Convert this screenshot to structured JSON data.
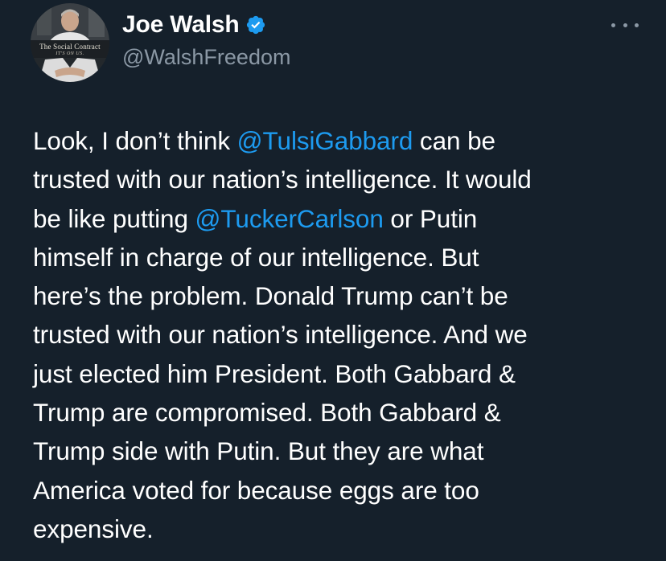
{
  "author": {
    "display_name": "Joe Walsh",
    "handle": "@WalshFreedom",
    "verified": true,
    "avatar": {
      "title": "The Social Contract",
      "subtitle": "IT'S ON US."
    }
  },
  "more_icon": "more-horizontal-icon",
  "colors": {
    "background": "#15202b",
    "text": "#ffffff",
    "secondary": "#8b98a5",
    "accent": "#1d9bf0"
  },
  "tweet": {
    "lines": [
      [
        {
          "text": "Look, I don’t think "
        },
        {
          "text": "@TulsiGabbard",
          "mention": true
        },
        {
          "text": " can be"
        }
      ],
      [
        {
          "text": "trusted with our nation’s intelligence. It would"
        }
      ],
      [
        {
          "text": "be like putting "
        },
        {
          "text": "@TuckerCarlson",
          "mention": true
        },
        {
          "text": " or Putin"
        }
      ],
      [
        {
          "text": "himself in charge of our intelligence. But"
        }
      ],
      [
        {
          "text": "here’s the problem. Donald Trump can’t be"
        }
      ],
      [
        {
          "text": "trusted with our nation’s intelligence. And we"
        }
      ],
      [
        {
          "text": "just elected him President. Both Gabbard &"
        }
      ],
      [
        {
          "text": "Trump are compromised. Both Gabbard &"
        }
      ],
      [
        {
          "text": "Trump side with Putin. But they are what"
        }
      ],
      [
        {
          "text": "America voted for because eggs are too"
        }
      ],
      [
        {
          "text": "expensive."
        }
      ]
    ]
  }
}
